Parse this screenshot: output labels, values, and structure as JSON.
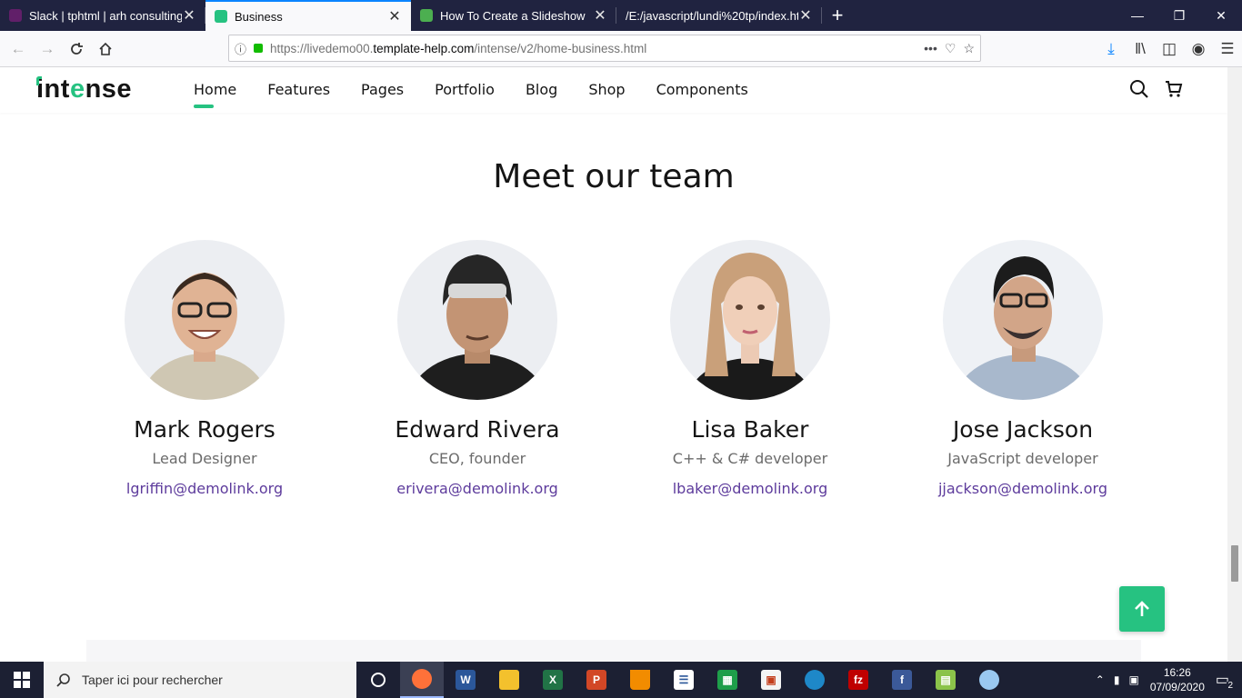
{
  "browser": {
    "tabs": [
      {
        "title": "Slack | tphtml | arh consulting",
        "favicon_color": "#611f69"
      },
      {
        "title": "Business",
        "favicon_color": "#26c281"
      },
      {
        "title": "How To Create a Slideshow",
        "favicon_color": "#4caf50"
      },
      {
        "title": "/E:/javascript/lundi%20tp/index.htm",
        "favicon_color": "#aaaaaa"
      }
    ],
    "url_prefix": "https://livedemo00.",
    "url_domain": "template-help.com",
    "url_path": "/intense/v2/home-business.html"
  },
  "site": {
    "logo_pre": "int",
    "logo_e": "e",
    "logo_post": "nse",
    "nav": [
      "Home",
      "Features",
      "Pages",
      "Portfolio",
      "Blog",
      "Shop",
      "Components"
    ],
    "accent": "#26c281",
    "link_color": "#5d3b9c"
  },
  "section": {
    "title": "Meet our team"
  },
  "team": [
    {
      "name": "Mark Rogers",
      "role": "Lead Designer",
      "email": "lgriffin@demolink.org"
    },
    {
      "name": "Edward Rivera",
      "role": "CEO, founder",
      "email": "erivera@demolink.org"
    },
    {
      "name": "Lisa Baker",
      "role": "C++ & C# developer",
      "email": "lbaker@demolink.org"
    },
    {
      "name": "Jose Jackson",
      "role": "JavaScript developer",
      "email": "jjackson@demolink.org"
    }
  ],
  "taskbar": {
    "search_placeholder": "Taper ici pour rechercher",
    "time": "16:26",
    "date": "07/09/2020",
    "notifications": "2"
  }
}
